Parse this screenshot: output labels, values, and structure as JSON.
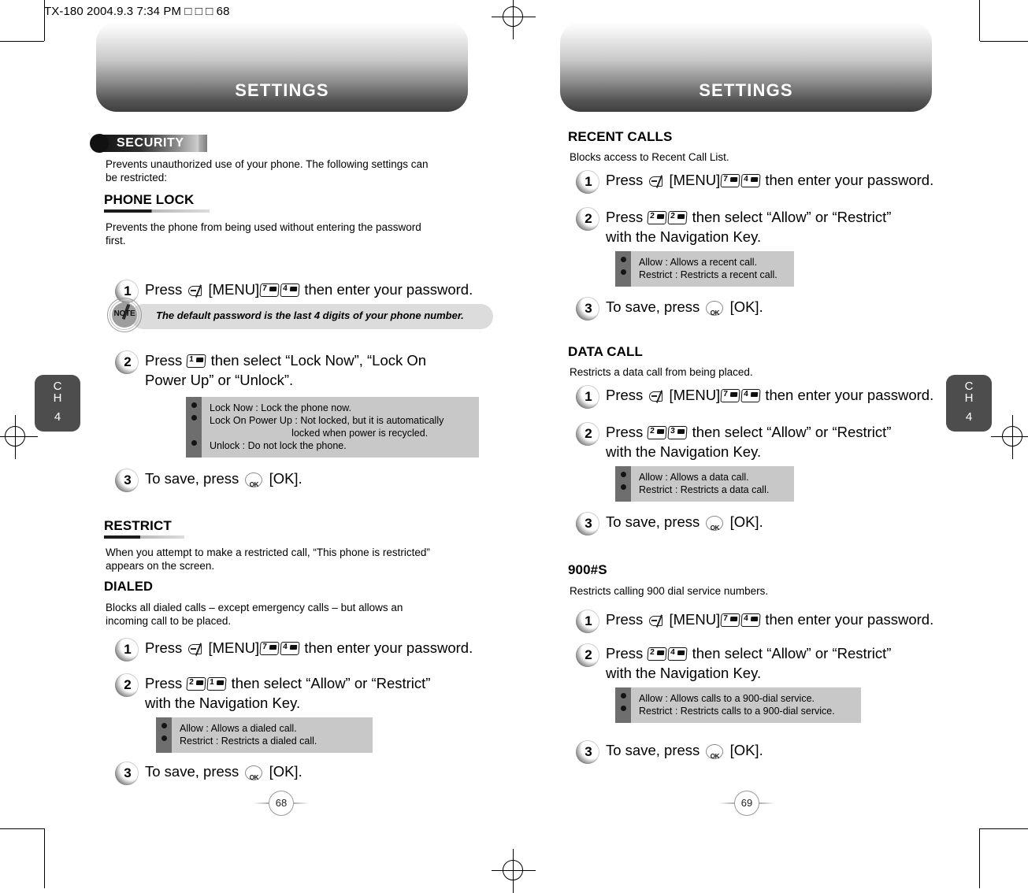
{
  "doc_header": "TX-180  2004.9.3 7:34 PM   □ □ □  68",
  "left_page": {
    "banner_title": "SETTINGS",
    "ribbon_label": "SECURITY",
    "intro": "Prevents unauthorized use of your phone. The following settings can\nbe restricted:",
    "phone_lock": {
      "heading": "PHONE LOCK",
      "desc": "Prevents the phone from being used without entering the password\nfirst.",
      "step1": {
        "num": "1",
        "pre": "Press",
        "bracket": "[MENU]",
        "keys": [
          "7",
          "4"
        ],
        "post": "then enter your password."
      },
      "note": "The default password is the last 4 digits of your phone number.",
      "note_badge": "NOTE",
      "step2": {
        "num": "2",
        "pre": "Press",
        "keys": [
          "1"
        ],
        "post_line1": "then select “Lock Now”, “Lock On",
        "post_line2": "Power Up” or “Unlock”."
      },
      "options": [
        "Lock Now : Lock the phone now.",
        "Lock On Power Up : Not locked, but it is automatically",
        "                              locked when power is recycled.",
        "Unlock : Do not lock the phone."
      ],
      "step3": {
        "num": "3",
        "pre": "To save, press",
        "post": "[OK]."
      }
    },
    "restrict": {
      "heading": "RESTRICT",
      "desc": "When you attempt to make a restricted call, “This phone is restricted”\nappears on the screen."
    },
    "dialed": {
      "heading": "DIALED",
      "desc": "Blocks all dialed calls – except emergency calls – but allows an\nincoming call to be placed.",
      "step1": {
        "num": "1",
        "pre": "Press",
        "bracket": "[MENU]",
        "keys": [
          "7",
          "4"
        ],
        "post": "then enter your password."
      },
      "step2": {
        "num": "2",
        "pre": "Press",
        "keys": [
          "2",
          "1"
        ],
        "post_line1": "then select “Allow” or “Restrict”",
        "post_line2": "with the Navigation Key."
      },
      "options": [
        "Allow : Allows a dialed call.",
        "Restrict : Restricts a dialed call."
      ],
      "step3": {
        "num": "3",
        "pre": "To save, press",
        "post": "[OK]."
      }
    },
    "chapter_tab": {
      "ch": "C\nH",
      "num": "4"
    },
    "page_number": "68"
  },
  "right_page": {
    "banner_title": "SETTINGS",
    "recent_calls": {
      "heading": "RECENT CALLS",
      "desc": "Blocks access to Recent Call List.",
      "step1": {
        "num": "1",
        "pre": "Press",
        "bracket": "[MENU]",
        "keys": [
          "7",
          "4"
        ],
        "post": "then enter your password."
      },
      "step2": {
        "num": "2",
        "pre": "Press",
        "keys": [
          "2",
          "2"
        ],
        "post_line1": "then select “Allow” or “Restrict”",
        "post_line2": "with the Navigation Key."
      },
      "options": [
        "Allow : Allows a recent call.",
        "Restrict : Restricts a recent call."
      ],
      "step3": {
        "num": "3",
        "pre": "To save, press",
        "post": "[OK]."
      }
    },
    "data_call": {
      "heading": "DATA CALL",
      "desc": "Restricts a data call from being placed.",
      "step1": {
        "num": "1",
        "pre": "Press",
        "bracket": "[MENU]",
        "keys": [
          "7",
          "4"
        ],
        "post": "then enter your password."
      },
      "step2": {
        "num": "2",
        "pre": "Press",
        "keys": [
          "2",
          "3"
        ],
        "post_line1": "then select “Allow” or “Restrict”",
        "post_line2": "with the Navigation Key."
      },
      "options": [
        "Allow : Allows a data call.",
        "Restrict : Restricts a data call."
      ],
      "step3": {
        "num": "3",
        "pre": "To save, press",
        "post": "[OK]."
      }
    },
    "nine_hundred": {
      "heading": "900#S",
      "desc": "Restricts calling 900 dial service numbers.",
      "step1": {
        "num": "1",
        "pre": "Press",
        "bracket": "[MENU]",
        "keys": [
          "7",
          "4"
        ],
        "post": "then enter your password."
      },
      "step2": {
        "num": "2",
        "pre": "Press",
        "keys": [
          "2",
          "4"
        ],
        "post_line1": "then select “Allow” or “Restrict”",
        "post_line2": "with the Navigation Key."
      },
      "options": [
        "Allow : Allows calls to a 900-dial service.",
        "Restrict : Restricts calls to a 900-dial service."
      ],
      "step3": {
        "num": "3",
        "pre": "To save, press",
        "post": "[OK]."
      }
    },
    "chapter_tab": {
      "ch": "C\nH",
      "num": "4"
    },
    "page_number": "69"
  }
}
